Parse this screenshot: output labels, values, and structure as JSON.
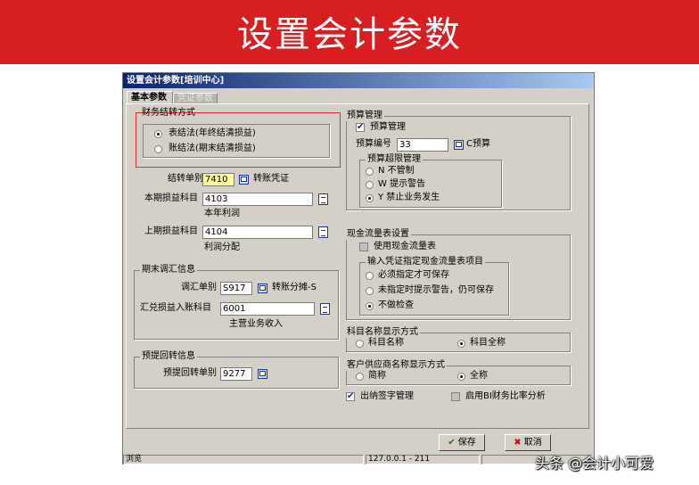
{
  "banner": {
    "title": "设置会计参数"
  },
  "window": {
    "title": "设置会计参数[培训中心]"
  },
  "tabs": [
    {
      "label": "基本参数"
    },
    {
      "label": "凭证参数"
    }
  ],
  "finance_transfer": {
    "title": "财务结转方式",
    "opt1": "表结法(年终结清损益)",
    "opt2": "账结法(期末结清损益)"
  },
  "transfer": {
    "voucher_label": "结转单别",
    "voucher_value": "7410",
    "voucher_desc": "转账凭证",
    "pl_label": "本期损益科目",
    "pl_value": "4103",
    "pl_desc": "本年利润",
    "prev_label": "上期损益科目",
    "prev_value": "4104",
    "prev_desc": "利润分配"
  },
  "period_adjust": {
    "title": "期末调汇信息",
    "voucher_label": "调汇单别",
    "voucher_value": "S917",
    "voucher_desc": "转账分摊-S",
    "acct_label": "汇兑损益入账科目",
    "acct_value": "6001",
    "acct_desc": "主营业务收入"
  },
  "accrual": {
    "title": "预提回转信息",
    "voucher_label": "预提回转单别",
    "voucher_value": "9277"
  },
  "budget": {
    "title": "预算管理",
    "check_label": "预算管理",
    "code_label": "预算编号",
    "code_value": "33",
    "code_desc": "C预算"
  },
  "over_budget": {
    "title": "预算超限管理",
    "opt_n": "N 不管制",
    "opt_w": "W 提示警告",
    "opt_y": "Y 禁止业务发生"
  },
  "cashflow": {
    "title": "现金流量表设置",
    "check_label": "使用现金流量表",
    "sub_title": "输入凭证指定现金流量表项目",
    "opt1": "必须指定才可保存",
    "opt2": "未指定时提示警告，仍可保存",
    "opt3": "不做检查"
  },
  "account_name": {
    "title": "科目名称显示方式",
    "opt1": "科目名称",
    "opt2": "科目全称"
  },
  "vendor_name": {
    "title": "客户供应商名称显示方式",
    "opt1": "简称",
    "opt2": "全称"
  },
  "bottom_checks": {
    "cashier": "出纳签字管理",
    "bi": "启用BI财务比率分析"
  },
  "buttons": {
    "save": "保存",
    "cancel": "取消"
  },
  "status": {
    "left": "浏览",
    "middle": "127.0.0.1 - 211"
  },
  "watermark": "头条 @会计小可爱",
  "colors": {
    "banner": "#d71f22",
    "window_bg": "#d4d0c8",
    "highlight": "#e0303a",
    "input_yellow": "#ffff99"
  }
}
